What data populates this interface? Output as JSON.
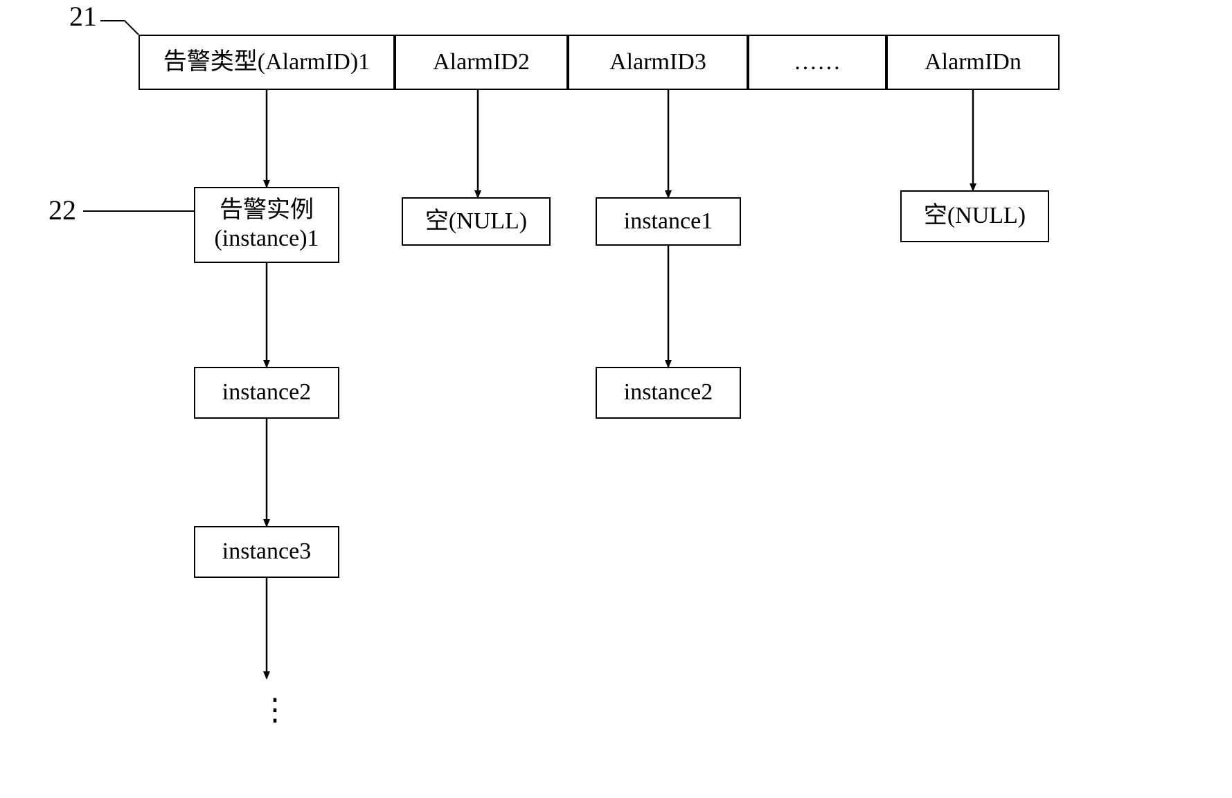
{
  "labels": {
    "ref21": "21",
    "ref22": "22"
  },
  "header": {
    "cells": [
      "告警类型(AlarmID)1",
      "AlarmID2",
      "AlarmID3",
      "……",
      "AlarmIDn"
    ]
  },
  "columns": {
    "col1": {
      "instance1": "告警实例\n(instance)1",
      "instance2": "instance2",
      "instance3": "instance3",
      "more": "⋮"
    },
    "col2": {
      "null": "空(NULL)"
    },
    "col3": {
      "instance1": "instance1",
      "instance2": "instance2"
    },
    "col5": {
      "null": "空(NULL)"
    }
  }
}
